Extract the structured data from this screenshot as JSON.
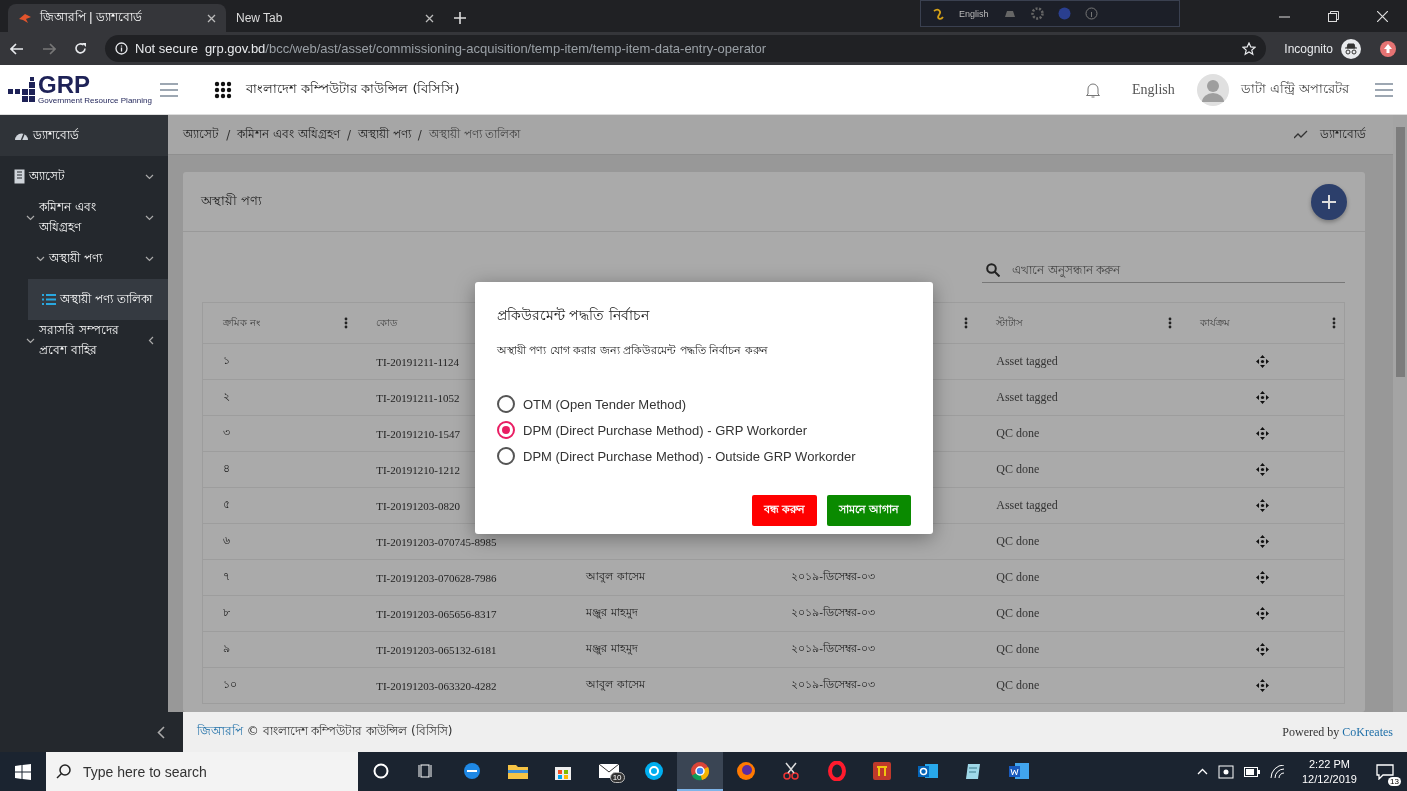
{
  "browser": {
    "tabs": [
      {
        "title": "জিআরপি | ড্যাশবোর্ড",
        "selected": true
      },
      {
        "title": "New Tab",
        "selected": false
      }
    ],
    "language_bar": {
      "label": "English"
    },
    "address_bar": {
      "security": "Not secure",
      "host": "grp.gov.bd",
      "path": "/bcc/web/ast/asset/commissioning-acquisition/temp-item/temp-item-data-entry-operator"
    },
    "profile": "Incognito"
  },
  "header": {
    "logo": "GRP",
    "logo_caption": "Government Resource Planning",
    "organization": "বাংলাদেশ কম্পিউটার কাউন্সিল (বিসিসি)",
    "language": "English",
    "user": "ডাটা এন্ট্রি অপারেটর"
  },
  "sidebar": {
    "items": [
      {
        "label": "ড্যাশবোর্ড",
        "kind": "dashboard",
        "selected": false
      },
      {
        "label": "অ্যাসেট",
        "kind": "section",
        "selected": false,
        "expanded": true,
        "children": [
          {
            "label": "কমিশন এবং অধিগ্রহণ",
            "kind": "folder",
            "selected": false,
            "expanded": true,
            "children": [
              {
                "label": "অস্থায়ী পণ্য",
                "kind": "folder",
                "selected": false,
                "expanded": true,
                "children": [
                  {
                    "label": "অস্থায়ী পণ্য তালিকা",
                    "kind": "page",
                    "selected": true
                  }
                ]
              }
            ]
          },
          {
            "label": "সরাসরি সম্পদের প্রবেশ বাহির",
            "kind": "folder",
            "selected": false,
            "expanded": false
          }
        ]
      }
    ]
  },
  "breadcrumb": {
    "items": [
      {
        "label": "অ্যাসেট",
        "kind": "link"
      },
      {
        "label": "/",
        "kind": "separator"
      },
      {
        "label": "কমিশন এবং অধিগ্রহণ",
        "kind": "link"
      },
      {
        "label": "/",
        "kind": "separator"
      },
      {
        "label": "অস্থায়ী পণ্য",
        "kind": "link"
      },
      {
        "label": "/",
        "kind": "separator"
      },
      {
        "label": "অস্থায়ী পণ্য তালিকা",
        "kind": "current"
      }
    ],
    "dashboard_link": "ড্যাশবোর্ড"
  },
  "card": {
    "title": "অস্থায়ী পণ্য",
    "search": {
      "placeholder": "এখানে অনুসন্ধান করুন"
    },
    "table": {
      "columns": [
        {
          "label": "ক্রমিক নং",
          "menu": true
        },
        {
          "label": "কোড"
        },
        {},
        {
          "menu": true
        },
        {
          "label": "স্টাটাস",
          "menu": true
        },
        {
          "label": "কার্যক্রম",
          "menu": true
        }
      ],
      "rows": [
        {
          "serial": "১",
          "code": "TI-20191211-1124",
          "status": "Asset tagged"
        },
        {
          "serial": "২",
          "code": "TI-20191211-1052",
          "status": "Asset tagged"
        },
        {
          "serial": "৩",
          "code": "TI-20191210-1547",
          "status": "QC done"
        },
        {
          "serial": "৪",
          "code": "TI-20191210-1212",
          "status": "QC done"
        },
        {
          "serial": "৫",
          "code": "TI-20191203-0820",
          "status": "Asset tagged"
        },
        {
          "serial": "৬",
          "code": "TI-20191203-070745-8985",
          "status": "QC done"
        },
        {
          "serial": "৭",
          "code": "TI-20191203-070628-7986",
          "name": "আবুল কাসেম",
          "date": "২০১৯-ডিসেম্বর-০৩",
          "status": "QC done"
        },
        {
          "serial": "৮",
          "code": "TI-20191203-065656-8317",
          "name": "মঞ্জুর মাহমুদ",
          "date": "২০১৯-ডিসেম্বর-০৩",
          "status": "QC done"
        },
        {
          "serial": "৯",
          "code": "TI-20191203-065132-6181",
          "name": "মঞ্জুর মাহমুদ",
          "date": "২০১৯-ডিসেম্বর-০৩",
          "status": "QC done"
        },
        {
          "serial": "১০",
          "code": "TI-20191203-063320-4282",
          "name": "আবুল কাসেম",
          "date": "২০১৯-ডিসেম্বর-০৩",
          "status": "QC done"
        }
      ]
    }
  },
  "dialog": {
    "title": "প্রকিউরমেন্ট পদ্ধতি নির্বাচন",
    "message": "অস্থায়ী পণ্য যোগ করার জন্য প্রকিউরমেন্ট পদ্ধতি নির্বাচন করুন",
    "options": [
      {
        "label": "OTM (Open Tender Method)",
        "selected": false
      },
      {
        "label": "DPM (Direct Purchase Method) - GRP Workorder",
        "selected": true
      },
      {
        "label": "DPM (Direct Purchase Method) - Outside GRP Workorder",
        "selected": false
      }
    ],
    "buttons": [
      {
        "label": "বন্ধ করুন",
        "kind": "danger"
      },
      {
        "label": "সামনে আগান",
        "kind": "success"
      }
    ]
  },
  "footer": {
    "brand": "জিআরপি",
    "copyright": "© বাংলাদেশ কম্পিউটার কাউন্সিল (বিসিসি)",
    "powered_by": "Powered by",
    "vendor": "CoKreates"
  },
  "taskbar": {
    "search": {
      "placeholder": "Type here to search"
    },
    "apps": [
      {
        "kind": "cortana",
        "selected": false
      },
      {
        "kind": "taskview",
        "selected": false
      },
      {
        "kind": "edge",
        "selected": false
      },
      {
        "kind": "explorer",
        "selected": false
      },
      {
        "kind": "store",
        "selected": false
      },
      {
        "kind": "mail",
        "selected": false,
        "badge": "10"
      },
      {
        "kind": "skype",
        "selected": false
      },
      {
        "kind": "chrome",
        "selected": true
      },
      {
        "kind": "firefox",
        "selected": false
      },
      {
        "kind": "snip",
        "selected": false
      },
      {
        "kind": "opera",
        "selected": false
      },
      {
        "kind": "bangla",
        "selected": false
      },
      {
        "kind": "outlook",
        "selected": false
      },
      {
        "kind": "notes",
        "selected": false
      },
      {
        "kind": "word",
        "selected": false
      }
    ],
    "time": "2:22 PM",
    "date": "12/12/2019",
    "notifications": "13"
  }
}
